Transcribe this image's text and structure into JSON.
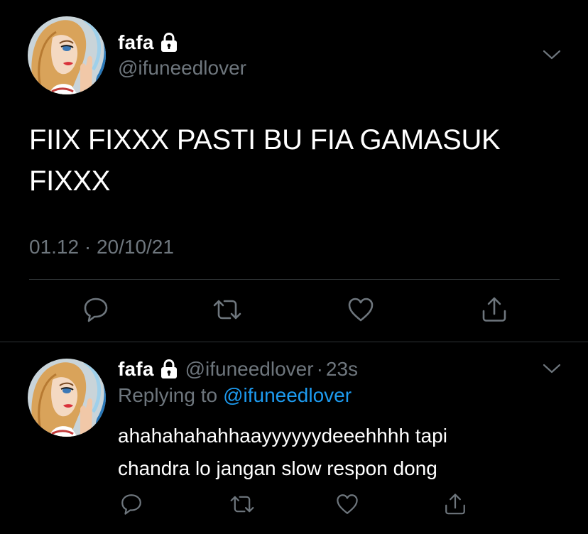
{
  "main_tweet": {
    "display_name": "fafa",
    "handle": "@ifuneedlover",
    "text_line1": "FIIX FIXXX PASTI BU FIA GAMASUK",
    "text_line2": "FIXXX",
    "timestamp": "01.12 · 20/10/21",
    "actions": [
      "reply-icon",
      "retweet-icon",
      "like-icon",
      "share-icon"
    ]
  },
  "reply_tweet": {
    "display_name": "fafa",
    "handle": "@ifuneedlover",
    "separator": "·",
    "age": "23s",
    "replying_prefix": "Replying to",
    "replying_to": "@ifuneedlover",
    "text_line1": "ahahahahahhaayyyyyydeeehhhh tapi",
    "text_line2": "chandra lo jangan slow respon dong",
    "actions": [
      "reply-icon",
      "retweet-icon",
      "like-icon",
      "share-icon"
    ]
  },
  "colors": {
    "background": "#000000",
    "primary_text": "#ffffff",
    "secondary_text": "#6e767d",
    "link": "#1d9bf0",
    "divider": "#2f3336"
  }
}
